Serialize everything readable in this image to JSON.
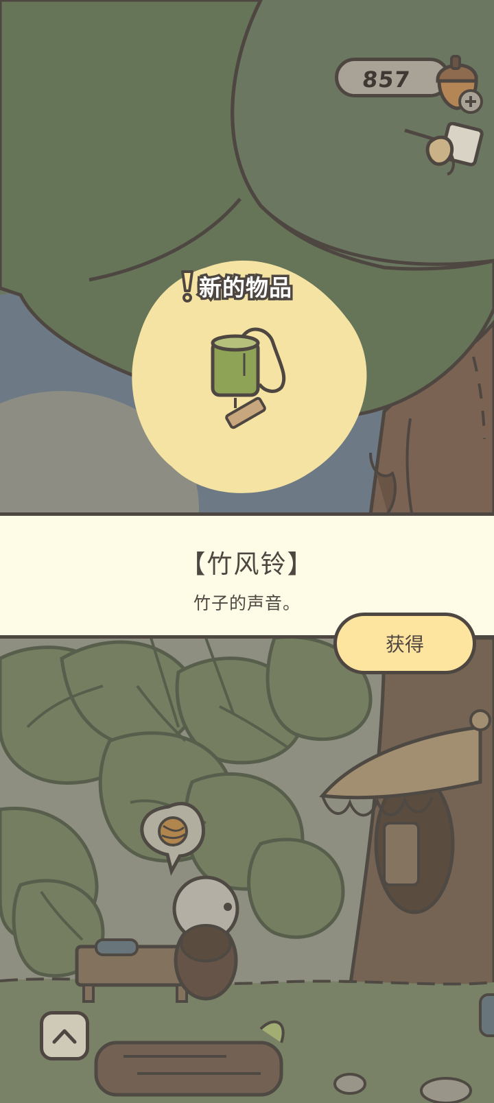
{
  "hud": {
    "acorn_count": "857",
    "acorn_icon": "acorn-plus-icon",
    "mail_icon": "mail-letter-icon"
  },
  "notification": {
    "new_item_label": "新的物品",
    "icon": "exclamation-icon"
  },
  "item": {
    "name": "【竹风铃】",
    "description": "竹子的声音。",
    "icon": "bamboo-wind-chime"
  },
  "actions": {
    "obtain_label": "获得",
    "expand_icon": "chevron-up-icon"
  },
  "colors": {
    "outline": "#4e4640",
    "panel_bg": "#fefbe6",
    "button_bg": "#fde49f",
    "highlight": "#f4e3a3",
    "foliage": "#667458"
  }
}
